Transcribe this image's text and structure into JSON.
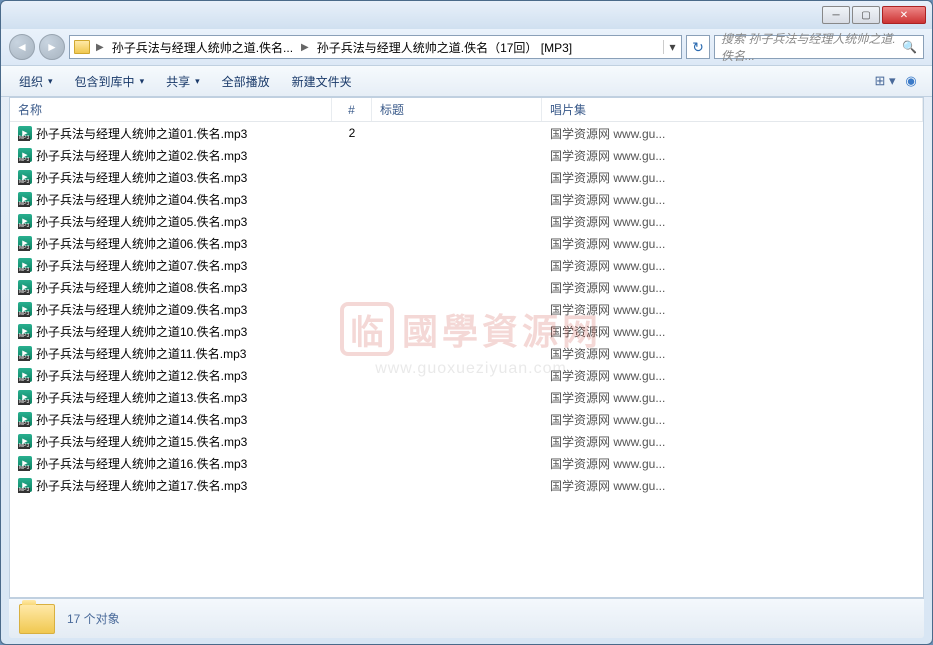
{
  "titlebar": {},
  "nav": {
    "breadcrumb1": "孙子兵法与经理人统帅之道.佚名...",
    "breadcrumb2": "孙子兵法与经理人统帅之道.佚名（17回） [MP3]",
    "search_placeholder": "搜索 孙子兵法与经理人统帅之道.佚名..."
  },
  "toolbar": {
    "organize": "组织",
    "include": "包含到库中",
    "share": "共享",
    "playall": "全部播放",
    "newfolder": "新建文件夹"
  },
  "columns": {
    "name": "名称",
    "num": "#",
    "title": "标题",
    "album": "唱片集"
  },
  "files": [
    {
      "name": "孙子兵法与经理人统帅之道01.佚名.mp3",
      "num": "2",
      "title": "",
      "album": "国学资源网 www.gu..."
    },
    {
      "name": "孙子兵法与经理人统帅之道02.佚名.mp3",
      "num": "",
      "title": "",
      "album": "国学资源网 www.gu..."
    },
    {
      "name": "孙子兵法与经理人统帅之道03.佚名.mp3",
      "num": "",
      "title": "",
      "album": "国学资源网 www.gu..."
    },
    {
      "name": "孙子兵法与经理人统帅之道04.佚名.mp3",
      "num": "",
      "title": "",
      "album": "国学资源网 www.gu..."
    },
    {
      "name": "孙子兵法与经理人统帅之道05.佚名.mp3",
      "num": "",
      "title": "",
      "album": "国学资源网 www.gu..."
    },
    {
      "name": "孙子兵法与经理人统帅之道06.佚名.mp3",
      "num": "",
      "title": "",
      "album": "国学资源网 www.gu..."
    },
    {
      "name": "孙子兵法与经理人统帅之道07.佚名.mp3",
      "num": "",
      "title": "",
      "album": "国学资源网 www.gu..."
    },
    {
      "name": "孙子兵法与经理人统帅之道08.佚名.mp3",
      "num": "",
      "title": "",
      "album": "国学资源网 www.gu..."
    },
    {
      "name": "孙子兵法与经理人统帅之道09.佚名.mp3",
      "num": "",
      "title": "",
      "album": "国学资源网 www.gu..."
    },
    {
      "name": "孙子兵法与经理人统帅之道10.佚名.mp3",
      "num": "",
      "title": "",
      "album": "国学资源网 www.gu..."
    },
    {
      "name": "孙子兵法与经理人统帅之道11.佚名.mp3",
      "num": "",
      "title": "",
      "album": "国学资源网 www.gu..."
    },
    {
      "name": "孙子兵法与经理人统帅之道12.佚名.mp3",
      "num": "",
      "title": "",
      "album": "国学资源网 www.gu..."
    },
    {
      "name": "孙子兵法与经理人统帅之道13.佚名.mp3",
      "num": "",
      "title": "",
      "album": "国学资源网 www.gu..."
    },
    {
      "name": "孙子兵法与经理人统帅之道14.佚名.mp3",
      "num": "",
      "title": "",
      "album": "国学资源网 www.gu..."
    },
    {
      "name": "孙子兵法与经理人统帅之道15.佚名.mp3",
      "num": "",
      "title": "",
      "album": "国学资源网 www.gu..."
    },
    {
      "name": "孙子兵法与经理人统帅之道16.佚名.mp3",
      "num": "",
      "title": "",
      "album": "国学资源网 www.gu..."
    },
    {
      "name": "孙子兵法与经理人统帅之道17.佚名.mp3",
      "num": "",
      "title": "",
      "album": "国学资源网 www.gu..."
    }
  ],
  "status": {
    "count": "17 个对象"
  },
  "watermark": {
    "stamp": "临",
    "text": "國學資源网",
    "url": "www.guoxueziyuan.com"
  }
}
